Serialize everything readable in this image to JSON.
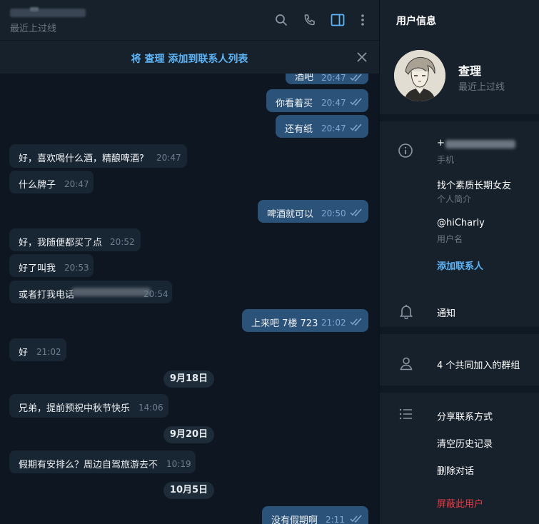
{
  "header": {
    "name_blur_text": "",
    "status": "最近上过线",
    "icons": [
      "search-icon",
      "phone-icon",
      "sidebar-toggle-icon",
      "more-vertical-icon"
    ]
  },
  "banner": {
    "add_contact_text": "将 查理 添加到联系人列表"
  },
  "messages": [
    {
      "dir": "out",
      "text": "酒吧",
      "time": "20:47",
      "read": true
    },
    {
      "dir": "out",
      "text": "你看着买",
      "time": "20:47",
      "read": true
    },
    {
      "dir": "out",
      "text": "还有纸",
      "time": "20:47",
      "read": true
    },
    {
      "dir": "in",
      "text": "好，喜欢喝什么酒，精酿啤酒?",
      "time": "20:47"
    },
    {
      "dir": "in",
      "text": "什么牌子",
      "time": "20:47"
    },
    {
      "dir": "out",
      "text": "啤酒就可以",
      "time": "20:50",
      "read": true
    },
    {
      "dir": "in",
      "text": "好，我随便都买了点",
      "time": "20:52"
    },
    {
      "dir": "in",
      "text": "好了叫我",
      "time": "20:53"
    },
    {
      "dir": "in",
      "text": "或者打我电话",
      "time": "20:54"
    },
    {
      "dir": "out",
      "text": "上来吧 7楼 723",
      "time": "21:02",
      "read": true
    },
    {
      "dir": "in",
      "text": "好",
      "time": "21:02"
    },
    {
      "dir": "in",
      "text": "兄弟，提前预祝中秋节快乐",
      "time": "14:06"
    },
    {
      "dir": "in",
      "text": "假期有安排么？周边自驾旅游去不",
      "time": "10:19"
    },
    {
      "dir": "out",
      "text": "没有假期啊",
      "time": "2:11",
      "read": true
    }
  ],
  "dates": [
    "9月18日",
    "9月20日",
    "10月5日"
  ],
  "info": {
    "title": "用户信息",
    "name": "查理",
    "status": "最近上过线",
    "phone_prefix": "+",
    "phone_label": "手机",
    "bio": "找个素质长期女友",
    "bio_label": "个人简介",
    "username": "@hiCharly",
    "username_label": "用户名",
    "add_contact": "添加联系人",
    "notifications": "通知",
    "groups": "4 个共同加入的群组",
    "share": "分享联系方式",
    "clear_history": "清空历史记录",
    "delete_chat": "删除对话",
    "block": "屏蔽此用户"
  },
  "colors": {
    "bg": "#0e1621",
    "panel": "#17212b",
    "bubble_in": "#182533",
    "bubble_out": "#2b5278",
    "accent": "#5eb5f7",
    "danger": "#ec3942"
  }
}
